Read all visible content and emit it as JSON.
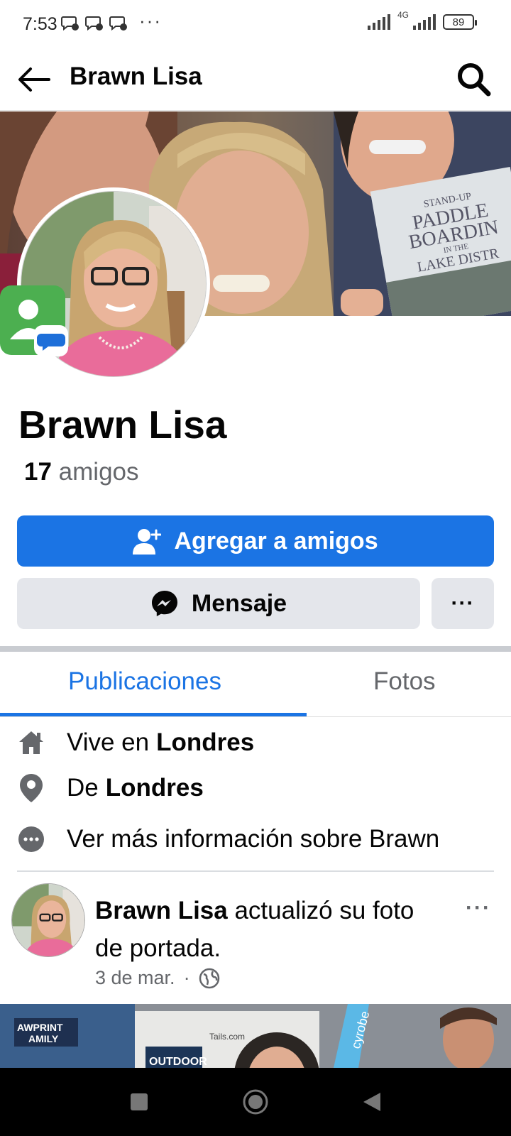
{
  "status_bar": {
    "time": "7:53",
    "more": "···",
    "network": "4G",
    "battery": "89"
  },
  "header": {
    "title": "Brawn Lisa",
    "back_icon": "arrow-left-icon",
    "search_icon": "search-icon"
  },
  "profile": {
    "name": "Brawn Lisa",
    "friends_count": "17",
    "friends_label": "amigos"
  },
  "actions": {
    "add_friend_label": "Agregar a amigos",
    "message_label": "Mensaje",
    "more_label": "···"
  },
  "tabs": [
    {
      "label": "Publicaciones",
      "active": true
    },
    {
      "label": "Fotos",
      "active": false
    }
  ],
  "info": {
    "lives_prefix": "Vive en",
    "lives_place": "Londres",
    "from_prefix": "De",
    "from_place": "Londres",
    "more_info": "Ver más información sobre Brawn"
  },
  "post": {
    "author": "Brawn Lisa",
    "action_line1": " actualizó su foto",
    "action_line2": "de portada.",
    "date": "3 de mar.",
    "separator": "·",
    "privacy_icon": "globe-icon",
    "more_label": "···"
  },
  "cover_book": {
    "line1": "STAND-UP",
    "line2": "PADDLE",
    "line3": "BOARDIN",
    "line4": "IN THE",
    "line5": "LAKE DISTR"
  },
  "photo_signs": {
    "sign1": "AWPRINT",
    "sign2": "AMILY",
    "sign3": "OUTDOOR",
    "sign4": "Tails.com",
    "sign5": "cyrobe"
  },
  "colors": {
    "accent": "#1b74e4",
    "secondary_button": "#e4e6eb",
    "muted_text": "#65676b"
  }
}
